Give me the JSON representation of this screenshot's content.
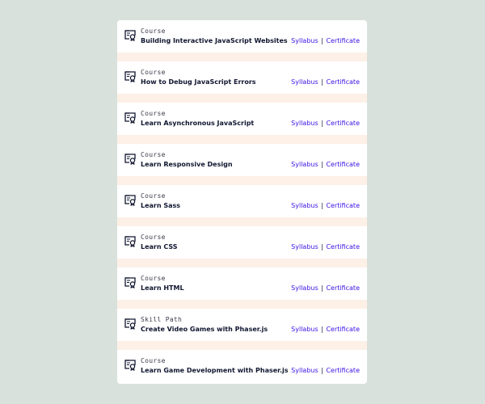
{
  "items": [
    {
      "type": "Course",
      "title": "Building Interactive JavaScript Websites",
      "syllabus": "Syllabus",
      "sep": "|",
      "certificate": "Certificate",
      "icon": "certificate-icon"
    },
    {
      "type": "Course",
      "title": "How to Debug JavaScript Errors",
      "syllabus": "Syllabus",
      "sep": "|",
      "certificate": "Certificate",
      "icon": "certificate-icon"
    },
    {
      "type": "Course",
      "title": "Learn Asynchronous JavaScript",
      "syllabus": "Syllabus",
      "sep": "|",
      "certificate": "Certificate",
      "icon": "certificate-icon"
    },
    {
      "type": "Course",
      "title": "Learn Responsive Design",
      "syllabus": "Syllabus",
      "sep": "|",
      "certificate": "Certificate",
      "icon": "certificate-icon"
    },
    {
      "type": "Course",
      "title": "Learn Sass",
      "syllabus": "Syllabus",
      "sep": "|",
      "certificate": "Certificate",
      "icon": "certificate-icon"
    },
    {
      "type": "Course",
      "title": "Learn CSS",
      "syllabus": "Syllabus",
      "sep": "|",
      "certificate": "Certificate",
      "icon": "certificate-icon"
    },
    {
      "type": "Course",
      "title": "Learn HTML",
      "syllabus": "Syllabus",
      "sep": "|",
      "certificate": "Certificate",
      "icon": "certificate-icon"
    },
    {
      "type": "Skill Path",
      "title": "Create Video Games with Phaser.js",
      "syllabus": "Syllabus",
      "sep": "|",
      "certificate": "Certificate",
      "icon": "certificate-icon"
    },
    {
      "type": "Course",
      "title": "Learn Game Development with Phaser.js",
      "syllabus": "Syllabus",
      "sep": "|",
      "certificate": "Certificate",
      "icon": "certificate-icon"
    }
  ],
  "colors": {
    "page_background": "#d9e1dc",
    "card_background": "#fdf0e6",
    "row_background": "#ffffff",
    "link": "#3a10e5",
    "title": "#10162f"
  }
}
